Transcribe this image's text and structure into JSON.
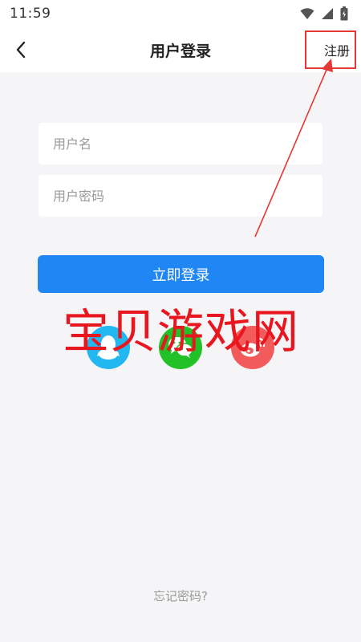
{
  "status_bar": {
    "time": "11:59",
    "icons": [
      "wifi-icon",
      "signal-icon",
      "battery-icon"
    ]
  },
  "header": {
    "title": "用户登录",
    "back_icon": "chevron-left-icon",
    "register_label": "注册"
  },
  "form": {
    "username_placeholder": "用户名",
    "username_value": "",
    "password_placeholder": "用户密码",
    "password_value": "",
    "login_label": "立即登录"
  },
  "social_login": [
    {
      "name": "qq",
      "icon": "qq-icon",
      "color": "#23b7f2"
    },
    {
      "name": "wechat",
      "icon": "wechat-icon",
      "color": "#22c128"
    },
    {
      "name": "weibo",
      "icon": "weibo-icon",
      "color": "#f25b5b"
    }
  ],
  "watermark": "宝贝游戏网",
  "forgot_password_label": "忘记密码?",
  "colors": {
    "accent": "#1f86f4",
    "annotation_red": "#e53935",
    "background": "#f5f5f7"
  }
}
